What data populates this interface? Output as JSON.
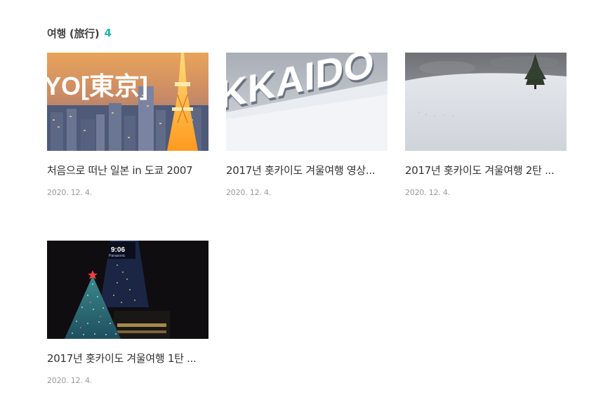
{
  "section": {
    "title": "여행 (旅行)",
    "count": "4"
  },
  "posts": [
    {
      "title": "처음으로 떠난 일본 in 도쿄 2007",
      "date": "2020. 12. 4.",
      "thumb_text": "YO[東京]"
    },
    {
      "title": "2017년 홋카이도 겨울여행 영상...",
      "date": "2020. 12. 4.",
      "thumb_text": "KKAIDO"
    },
    {
      "title": "2017년 홋카이도 겨울여행 2탄 ...",
      "date": "2020. 12. 4.",
      "thumb_text": ""
    },
    {
      "title": "2017년 홋카이도 겨울여행 1탄 ...",
      "date": "2020. 12. 4.",
      "thumb_text": "9:06",
      "thumb_subtext": "Panasonic"
    }
  ],
  "colors": {
    "accent": "#1fb5b5",
    "title": "#333333",
    "date": "#999999"
  }
}
